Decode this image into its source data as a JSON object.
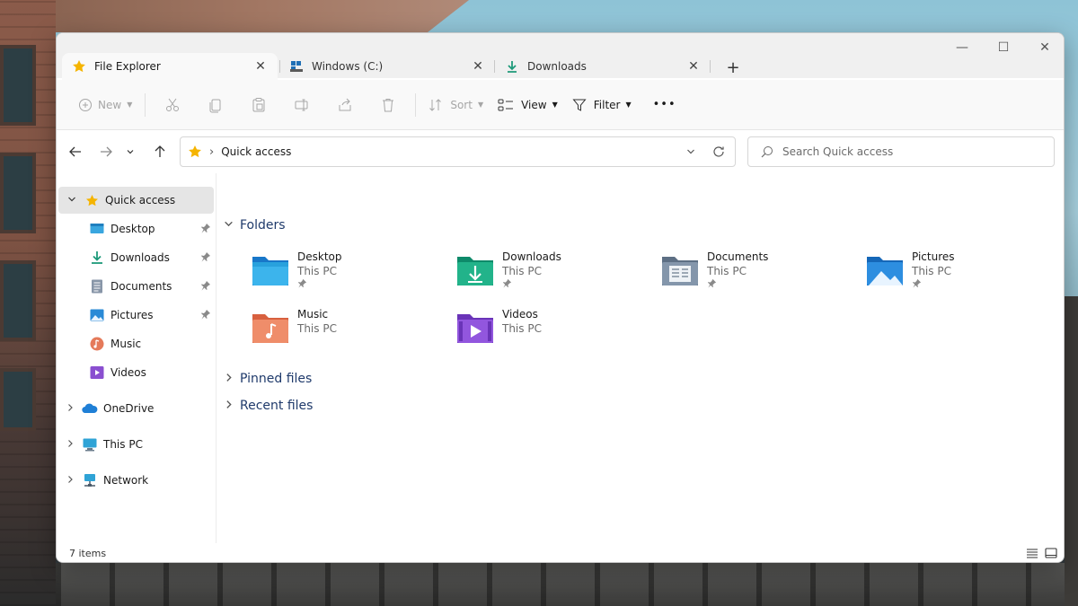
{
  "tabs": [
    {
      "label": "File Explorer",
      "icon": "star-icon",
      "close": "✕"
    },
    {
      "label": "Windows (C:)",
      "icon": "drive-icon",
      "close": "✕"
    },
    {
      "label": "Downloads",
      "icon": "download-icon",
      "close": "✕"
    }
  ],
  "new_tab": "+",
  "window_controls": {
    "minimize": "—",
    "maximize": "☐",
    "close": "✕"
  },
  "toolbar": {
    "new_label": "New",
    "sort_label": "Sort",
    "view_label": "View",
    "filter_label": "Filter",
    "more_label": "•••"
  },
  "address": {
    "separator": "›",
    "location": "Quick access",
    "chevron": "⌄"
  },
  "search": {
    "placeholder": "Search Quick access"
  },
  "sidebar": {
    "quick_access": "Quick access",
    "items": [
      {
        "label": "Desktop",
        "icon": "desktop-icon",
        "pinned": true
      },
      {
        "label": "Downloads",
        "icon": "download-icon",
        "pinned": true
      },
      {
        "label": "Documents",
        "icon": "documents-icon",
        "pinned": true
      },
      {
        "label": "Pictures",
        "icon": "pictures-icon",
        "pinned": true
      },
      {
        "label": "Music",
        "icon": "music-icon",
        "pinned": false
      },
      {
        "label": "Videos",
        "icon": "videos-icon",
        "pinned": false
      }
    ],
    "onedrive": "OneDrive",
    "this_pc": "This PC",
    "network": "Network"
  },
  "content": {
    "folders_heading": "Folders",
    "folders": [
      {
        "name": "Desktop",
        "location": "This PC",
        "pinned": true,
        "icon": "desktop-folder-icon"
      },
      {
        "name": "Downloads",
        "location": "This PC",
        "pinned": true,
        "icon": "downloads-folder-icon"
      },
      {
        "name": "Documents",
        "location": "This PC",
        "pinned": true,
        "icon": "documents-folder-icon"
      },
      {
        "name": "Pictures",
        "location": "This PC",
        "pinned": true,
        "icon": "pictures-folder-icon"
      },
      {
        "name": "Music",
        "location": "This PC",
        "pinned": false,
        "icon": "music-folder-icon"
      },
      {
        "name": "Videos",
        "location": "This PC",
        "pinned": false,
        "icon": "videos-folder-icon"
      }
    ],
    "pinned_files_heading": "Pinned files",
    "recent_files_heading": "Recent files"
  },
  "status": {
    "items_count": "7 items"
  },
  "colors": {
    "accent": "#0067c0",
    "section_heading": "#1f3a6b",
    "selected_bg": "#e5e5e5",
    "star": "#f5b400"
  }
}
